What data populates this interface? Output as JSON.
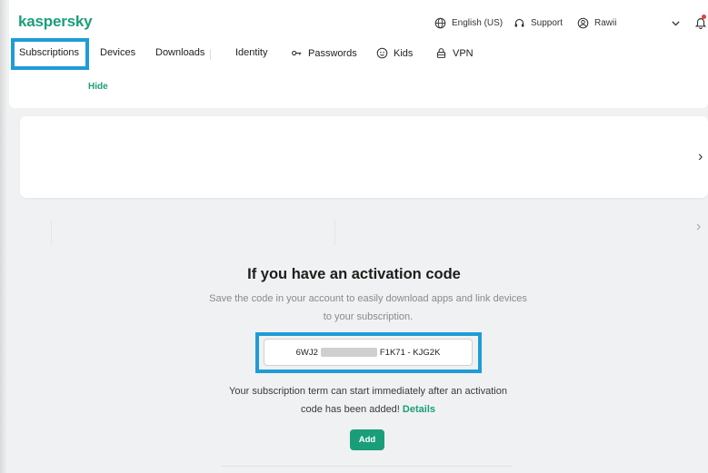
{
  "brand": {
    "logo": "kaspersky"
  },
  "utility": {
    "language": "English (US)",
    "support": "Support",
    "user": "Rawii"
  },
  "nav": {
    "items": [
      {
        "label": "Subscriptions"
      },
      {
        "label": "Devices"
      },
      {
        "label": "Downloads"
      },
      {
        "label": "Identity"
      },
      {
        "label": "Passwords"
      },
      {
        "label": "Kids"
      },
      {
        "label": "VPN"
      }
    ]
  },
  "hide_link": "Hide",
  "activation": {
    "title": "If you have an activation code",
    "description": "Save the code in your account to easily download apps and link devices to your subscription.",
    "code_prefix": "6WJ2",
    "code_suffix": "F1K71 - KJG2K",
    "term_text": "Your subscription term can start immediately after an activation code has been added!",
    "details_link": "Details",
    "add_button": "Add"
  },
  "colors": {
    "brand_green": "#1a9e7a",
    "highlight_blue": "#1f9cd8"
  }
}
